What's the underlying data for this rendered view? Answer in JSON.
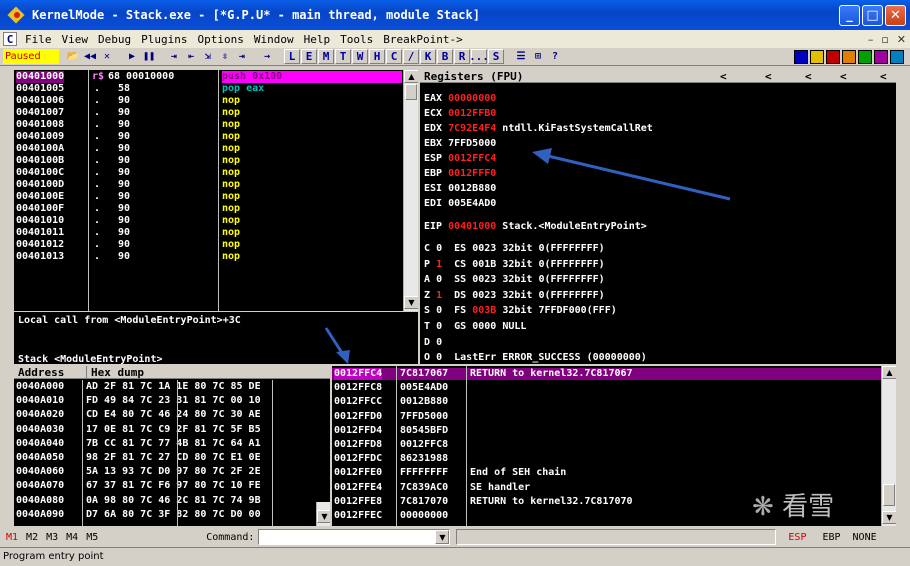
{
  "window": {
    "title": "KernelMode - Stack.exe - [*G.P.U* - main thread, module Stack]"
  },
  "window_controls": {
    "minimize": "_",
    "maximize": "□",
    "close": "✕"
  },
  "menu": {
    "logo": "C",
    "items": [
      "File",
      "View",
      "Debug",
      "Plugins",
      "Options",
      "Window",
      "Help",
      "Tools",
      "BreakPoint->"
    ],
    "mdi": [
      "–",
      "▫",
      "✕"
    ]
  },
  "toolbar": {
    "status": "Paused",
    "buttons": [
      "📂",
      "◀◀",
      "✕",
      "▶",
      "❚❚",
      "⇥",
      "⇤",
      "⇲",
      "⇳",
      "⇥",
      "→"
    ],
    "letters": [
      "L",
      "E",
      "M",
      "T",
      "W",
      "H",
      "C",
      "/",
      "K",
      "B",
      "R",
      "...",
      "S"
    ],
    "extra": [
      "☰",
      "⊞",
      "?"
    ],
    "color_icons": [
      "#0000c0",
      "#e0c000",
      "#c00000",
      "#e08000",
      "#00a000",
      "#a000a0",
      "#0080c0"
    ]
  },
  "disasm": {
    "rows": [
      {
        "addr": "00401000",
        "mark": "r$",
        "hex": "68 00010000",
        "asm": "push 0x100",
        "addr_bg": "#800080",
        "asm_color": "#800080",
        "asm_bg": "#ff00ff"
      },
      {
        "addr": "00401005",
        "mark": ".",
        "hex": "58",
        "asm": "pop eax",
        "asm_color": "#00c0c0"
      },
      {
        "addr": "00401006",
        "mark": ".",
        "hex": "90",
        "asm": "nop",
        "asm_color": "#ffff00"
      },
      {
        "addr": "00401007",
        "mark": ".",
        "hex": "90",
        "asm": "nop",
        "asm_color": "#ffff00"
      },
      {
        "addr": "00401008",
        "mark": ".",
        "hex": "90",
        "asm": "nop",
        "asm_color": "#ffff00"
      },
      {
        "addr": "00401009",
        "mark": ".",
        "hex": "90",
        "asm": "nop",
        "asm_color": "#ffff00"
      },
      {
        "addr": "0040100A",
        "mark": ".",
        "hex": "90",
        "asm": "nop",
        "asm_color": "#ffff00"
      },
      {
        "addr": "0040100B",
        "mark": ".",
        "hex": "90",
        "asm": "nop",
        "asm_color": "#ffff00"
      },
      {
        "addr": "0040100C",
        "mark": ".",
        "hex": "90",
        "asm": "nop",
        "asm_color": "#ffff00"
      },
      {
        "addr": "0040100D",
        "mark": ".",
        "hex": "90",
        "asm": "nop",
        "asm_color": "#ffff00"
      },
      {
        "addr": "0040100E",
        "mark": ".",
        "hex": "90",
        "asm": "nop",
        "asm_color": "#ffff00"
      },
      {
        "addr": "0040100F",
        "mark": ".",
        "hex": "90",
        "asm": "nop",
        "asm_color": "#ffff00"
      },
      {
        "addr": "00401010",
        "mark": ".",
        "hex": "90",
        "asm": "nop",
        "asm_color": "#ffff00"
      },
      {
        "addr": "00401011",
        "mark": ".",
        "hex": "90",
        "asm": "nop",
        "asm_color": "#ffff00"
      },
      {
        "addr": "00401012",
        "mark": ".",
        "hex": "90",
        "asm": "nop",
        "asm_color": "#ffff00"
      },
      {
        "addr": "00401013",
        "mark": ".",
        "hex": "90",
        "asm": "nop",
        "asm_color": "#ffff00"
      }
    ],
    "info": "Local call from <ModuleEntryPoint>+3C",
    "info2": "Stack <ModuleEntryPoint>"
  },
  "registers": {
    "header": "Registers (FPU)",
    "header_arrows": [
      "<",
      "<",
      "<",
      "<",
      "<"
    ],
    "gp": [
      {
        "name": "EAX",
        "value": "00000000",
        "red": true,
        "comment": ""
      },
      {
        "name": "ECX",
        "value": "0012FFB0",
        "red": true,
        "comment": ""
      },
      {
        "name": "EDX",
        "value": "7C92E4F4",
        "red": true,
        "comment": "ntdll.KiFastSystemCallRet"
      },
      {
        "name": "EBX",
        "value": "7FFD5000",
        "red": false,
        "comment": ""
      },
      {
        "name": "ESP",
        "value": "0012FFC4",
        "red": true,
        "comment": ""
      },
      {
        "name": "EBP",
        "value": "0012FFF0",
        "red": true,
        "comment": ""
      },
      {
        "name": "ESI",
        "value": "0012B880",
        "red": false,
        "comment": ""
      },
      {
        "name": "EDI",
        "value": "005E4AD0",
        "red": false,
        "comment": ""
      }
    ],
    "eip": {
      "name": "EIP",
      "value": "00401000",
      "comment": "Stack.<ModuleEntryPoint>"
    },
    "flags": [
      {
        "f": "C",
        "v": "0",
        "v_red": false,
        "seg": "ES",
        "sel": "0023",
        "sel_red": false,
        "rest": "32bit 0(FFFFFFFF)"
      },
      {
        "f": "P",
        "v": "1",
        "v_red": true,
        "seg": "CS",
        "sel": "001B",
        "sel_red": false,
        "rest": "32bit 0(FFFFFFFF)"
      },
      {
        "f": "A",
        "v": "0",
        "v_red": false,
        "seg": "SS",
        "sel": "0023",
        "sel_red": false,
        "rest": "32bit 0(FFFFFFFF)"
      },
      {
        "f": "Z",
        "v": "1",
        "v_red": true,
        "seg": "DS",
        "sel": "0023",
        "sel_red": false,
        "rest": "32bit 0(FFFFFFFF)"
      },
      {
        "f": "S",
        "v": "0",
        "v_red": false,
        "seg": "FS",
        "sel": "003B",
        "sel_red": true,
        "rest": "32bit 7FFDF000(FFF)"
      },
      {
        "f": "T",
        "v": "0",
        "v_red": false,
        "seg": "GS",
        "sel": "0000",
        "sel_red": false,
        "rest": "NULL"
      },
      {
        "f": "D",
        "v": "0",
        "v_red": false,
        "seg": "",
        "sel": "",
        "sel_red": false,
        "rest": ""
      },
      {
        "f": "O",
        "v": "0",
        "v_red": false,
        "seg": "",
        "sel": "",
        "sel_red": false,
        "rest": "LastErr ERROR_SUCCESS (00000000)"
      }
    ]
  },
  "dump": {
    "header_address": "Address",
    "header_hex": "Hex dump",
    "rows": [
      {
        "addr": "0040A000",
        "hex": "AD 2F 81 7C 1A 1E 80 7C 85 DE"
      },
      {
        "addr": "0040A010",
        "hex": "FD 49 84 7C 23 31 81 7C 00 10"
      },
      {
        "addr": "0040A020",
        "hex": "CD E4 80 7C 46 24 80 7C 30 AE"
      },
      {
        "addr": "0040A030",
        "hex": "17 0E 81 7C C9 2F 81 7C 5F B5"
      },
      {
        "addr": "0040A040",
        "hex": "7B CC 81 7C 77 4B 81 7C 64 A1"
      },
      {
        "addr": "0040A050",
        "hex": "98 2F 81 7C 27 CD 80 7C E1 0E"
      },
      {
        "addr": "0040A060",
        "hex": "5A 13 93 7C D0 97 80 7C 2F 2E"
      },
      {
        "addr": "0040A070",
        "hex": "67 37 81 7C F6 97 80 7C 10 FE"
      },
      {
        "addr": "0040A080",
        "hex": "0A 98 80 7C 46 2C 81 7C 74 9B"
      },
      {
        "addr": "0040A090",
        "hex": "D7 6A 80 7C 3F 82 80 7C D0 00"
      }
    ]
  },
  "stack": {
    "rows": [
      {
        "addr": "0012FFC4",
        "value": "7C817067",
        "comment": "RETURN to kernel32.7C817067",
        "highlight": true
      },
      {
        "addr": "0012FFC8",
        "value": "005E4AD0",
        "comment": "",
        "highlight": false
      },
      {
        "addr": "0012FFCC",
        "value": "0012B880",
        "comment": "",
        "highlight": false
      },
      {
        "addr": "0012FFD0",
        "value": "7FFD5000",
        "comment": "",
        "highlight": false
      },
      {
        "addr": "0012FFD4",
        "value": "80545BFD",
        "comment": "",
        "highlight": false
      },
      {
        "addr": "0012FFD8",
        "value": "0012FFC8",
        "comment": "",
        "highlight": false
      },
      {
        "addr": "0012FFDC",
        "value": "86231988",
        "comment": "",
        "highlight": false
      },
      {
        "addr": "0012FFE0",
        "value": "FFFFFFFF",
        "comment": "End of SEH chain",
        "highlight": false
      },
      {
        "addr": "0012FFE4",
        "value": "7C839AC0",
        "comment": "SE handler",
        "highlight": false
      },
      {
        "addr": "0012FFE8",
        "value": "7C817070",
        "comment": "RETURN to kernel32.7C817070",
        "highlight": false
      },
      {
        "addr": "0012FFEC",
        "value": "00000000",
        "comment": "",
        "highlight": false
      }
    ]
  },
  "bottom": {
    "marks": [
      "M1",
      "M2",
      "M3",
      "M4",
      "M5"
    ],
    "command_label": "Command:",
    "command_value": "",
    "right": [
      "ESP",
      "EBP",
      "NONE"
    ]
  },
  "status": {
    "text": "Program entry point"
  },
  "watermark": {
    "text": "看雪"
  },
  "colors": {
    "hl_purple": "#800080",
    "magenta": "#ff00ff",
    "red": "#ff2020",
    "yellow": "#ffff00",
    "cyan": "#00c0c0",
    "arrow": "#3060c0"
  }
}
